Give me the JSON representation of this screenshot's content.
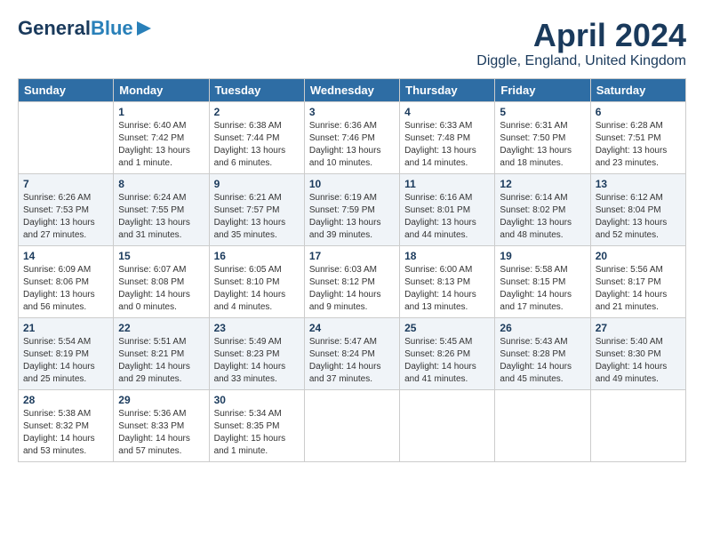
{
  "header": {
    "logo_line1": "General",
    "logo_line2": "Blue",
    "month": "April 2024",
    "location": "Diggle, England, United Kingdom"
  },
  "days_of_week": [
    "Sunday",
    "Monday",
    "Tuesday",
    "Wednesday",
    "Thursday",
    "Friday",
    "Saturday"
  ],
  "weeks": [
    [
      {
        "day": "",
        "info": ""
      },
      {
        "day": "1",
        "info": "Sunrise: 6:40 AM\nSunset: 7:42 PM\nDaylight: 13 hours\nand 1 minute."
      },
      {
        "day": "2",
        "info": "Sunrise: 6:38 AM\nSunset: 7:44 PM\nDaylight: 13 hours\nand 6 minutes."
      },
      {
        "day": "3",
        "info": "Sunrise: 6:36 AM\nSunset: 7:46 PM\nDaylight: 13 hours\nand 10 minutes."
      },
      {
        "day": "4",
        "info": "Sunrise: 6:33 AM\nSunset: 7:48 PM\nDaylight: 13 hours\nand 14 minutes."
      },
      {
        "day": "5",
        "info": "Sunrise: 6:31 AM\nSunset: 7:50 PM\nDaylight: 13 hours\nand 18 minutes."
      },
      {
        "day": "6",
        "info": "Sunrise: 6:28 AM\nSunset: 7:51 PM\nDaylight: 13 hours\nand 23 minutes."
      }
    ],
    [
      {
        "day": "7",
        "info": "Sunrise: 6:26 AM\nSunset: 7:53 PM\nDaylight: 13 hours\nand 27 minutes."
      },
      {
        "day": "8",
        "info": "Sunrise: 6:24 AM\nSunset: 7:55 PM\nDaylight: 13 hours\nand 31 minutes."
      },
      {
        "day": "9",
        "info": "Sunrise: 6:21 AM\nSunset: 7:57 PM\nDaylight: 13 hours\nand 35 minutes."
      },
      {
        "day": "10",
        "info": "Sunrise: 6:19 AM\nSunset: 7:59 PM\nDaylight: 13 hours\nand 39 minutes."
      },
      {
        "day": "11",
        "info": "Sunrise: 6:16 AM\nSunset: 8:01 PM\nDaylight: 13 hours\nand 44 minutes."
      },
      {
        "day": "12",
        "info": "Sunrise: 6:14 AM\nSunset: 8:02 PM\nDaylight: 13 hours\nand 48 minutes."
      },
      {
        "day": "13",
        "info": "Sunrise: 6:12 AM\nSunset: 8:04 PM\nDaylight: 13 hours\nand 52 minutes."
      }
    ],
    [
      {
        "day": "14",
        "info": "Sunrise: 6:09 AM\nSunset: 8:06 PM\nDaylight: 13 hours\nand 56 minutes."
      },
      {
        "day": "15",
        "info": "Sunrise: 6:07 AM\nSunset: 8:08 PM\nDaylight: 14 hours\nand 0 minutes."
      },
      {
        "day": "16",
        "info": "Sunrise: 6:05 AM\nSunset: 8:10 PM\nDaylight: 14 hours\nand 4 minutes."
      },
      {
        "day": "17",
        "info": "Sunrise: 6:03 AM\nSunset: 8:12 PM\nDaylight: 14 hours\nand 9 minutes."
      },
      {
        "day": "18",
        "info": "Sunrise: 6:00 AM\nSunset: 8:13 PM\nDaylight: 14 hours\nand 13 minutes."
      },
      {
        "day": "19",
        "info": "Sunrise: 5:58 AM\nSunset: 8:15 PM\nDaylight: 14 hours\nand 17 minutes."
      },
      {
        "day": "20",
        "info": "Sunrise: 5:56 AM\nSunset: 8:17 PM\nDaylight: 14 hours\nand 21 minutes."
      }
    ],
    [
      {
        "day": "21",
        "info": "Sunrise: 5:54 AM\nSunset: 8:19 PM\nDaylight: 14 hours\nand 25 minutes."
      },
      {
        "day": "22",
        "info": "Sunrise: 5:51 AM\nSunset: 8:21 PM\nDaylight: 14 hours\nand 29 minutes."
      },
      {
        "day": "23",
        "info": "Sunrise: 5:49 AM\nSunset: 8:23 PM\nDaylight: 14 hours\nand 33 minutes."
      },
      {
        "day": "24",
        "info": "Sunrise: 5:47 AM\nSunset: 8:24 PM\nDaylight: 14 hours\nand 37 minutes."
      },
      {
        "day": "25",
        "info": "Sunrise: 5:45 AM\nSunset: 8:26 PM\nDaylight: 14 hours\nand 41 minutes."
      },
      {
        "day": "26",
        "info": "Sunrise: 5:43 AM\nSunset: 8:28 PM\nDaylight: 14 hours\nand 45 minutes."
      },
      {
        "day": "27",
        "info": "Sunrise: 5:40 AM\nSunset: 8:30 PM\nDaylight: 14 hours\nand 49 minutes."
      }
    ],
    [
      {
        "day": "28",
        "info": "Sunrise: 5:38 AM\nSunset: 8:32 PM\nDaylight: 14 hours\nand 53 minutes."
      },
      {
        "day": "29",
        "info": "Sunrise: 5:36 AM\nSunset: 8:33 PM\nDaylight: 14 hours\nand 57 minutes."
      },
      {
        "day": "30",
        "info": "Sunrise: 5:34 AM\nSunset: 8:35 PM\nDaylight: 15 hours\nand 1 minute."
      },
      {
        "day": "",
        "info": ""
      },
      {
        "day": "",
        "info": ""
      },
      {
        "day": "",
        "info": ""
      },
      {
        "day": "",
        "info": ""
      }
    ]
  ]
}
